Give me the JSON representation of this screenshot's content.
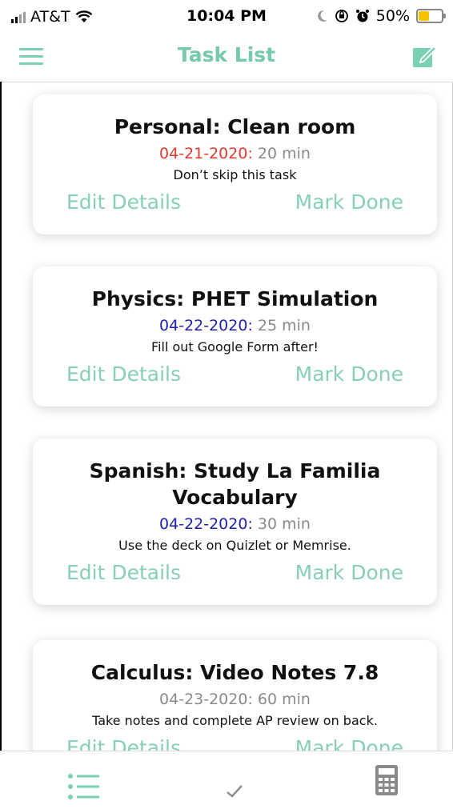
{
  "status_bar": {
    "carrier": "AT&T",
    "time": "10:04 PM",
    "battery": "50%",
    "battery_level": 0.5
  },
  "nav": {
    "title": "Task List",
    "icons": [
      "menu-icon",
      "compose-icon"
    ]
  },
  "colors": {
    "accent": "#76c9ad",
    "overdue": "#e03a2f",
    "upcoming": "#1f1fb0",
    "neutral": "#8a8a8a"
  },
  "tasks": [
    {
      "title": "Personal: Clean room",
      "date": "04-21-2020:",
      "duration": "20 min",
      "note": "Don’t skip this task",
      "edit_label": "Edit Details",
      "done_label": "Mark Done"
    },
    {
      "title": "Physics: PHET Simulation",
      "date": "04-22-2020:",
      "duration": "25 min",
      "note": "Fill out Google Form after!",
      "edit_label": "Edit Details",
      "done_label": "Mark Done"
    },
    {
      "title": "Spanish: Study La Familia Vocabulary",
      "date": "04-22-2020:",
      "duration": "30 min",
      "note": "Use the deck on Quizlet or Memrise.",
      "edit_label": "Edit Details",
      "done_label": "Mark Done"
    },
    {
      "title": "Calculus: Video Notes 7.8",
      "date": "04-23-2020:",
      "duration": "60 min",
      "note": "Take notes and complete AP review on back.",
      "edit_label": "Edit Details",
      "done_label": "Mark Done"
    }
  ],
  "tab_bar": {
    "icons": [
      "list-icon",
      "checkmark-icon",
      "calculator-icon"
    ]
  }
}
